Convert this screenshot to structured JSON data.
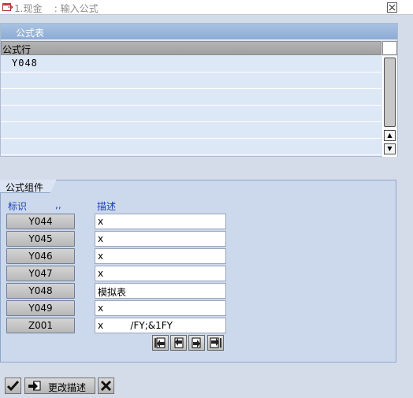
{
  "window": {
    "title": "1.现金    : 输入公式",
    "close_icon": "close-icon"
  },
  "formula_table": {
    "panel_title": "公式表",
    "column_header": "公式行",
    "rows": [
      "Y048",
      "",
      "",
      "",
      "",
      ""
    ]
  },
  "components": {
    "tab_title": "公式组件",
    "col_id": "标识",
    "col_id_marker": ",,",
    "col_desc": "描述",
    "items": [
      {
        "id": "Y044",
        "desc": "x"
      },
      {
        "id": "Y045",
        "desc": "x"
      },
      {
        "id": "Y046",
        "desc": "x"
      },
      {
        "id": "Y047",
        "desc": "x"
      },
      {
        "id": "Y048",
        "desc": "模拟表"
      },
      {
        "id": "Y049",
        "desc": "x"
      },
      {
        "id": "Z001",
        "desc": "x         /FY;&1FY"
      }
    ],
    "nav_icons": [
      "page-first-icon",
      "page-prev-icon",
      "page-next-icon",
      "page-last-icon"
    ]
  },
  "toolbar": {
    "confirm_icon": "checkmark-icon",
    "change_desc_label": "更改描述",
    "change_desc_icon": "edit-arrow-icon",
    "cancel_icon": "cancel-x-icon"
  },
  "colors": {
    "background": "#d4dcea",
    "panel_title": "#9ab6dc",
    "grid_row": "#dde8f7",
    "column_header_text": "#1c3fb8"
  }
}
